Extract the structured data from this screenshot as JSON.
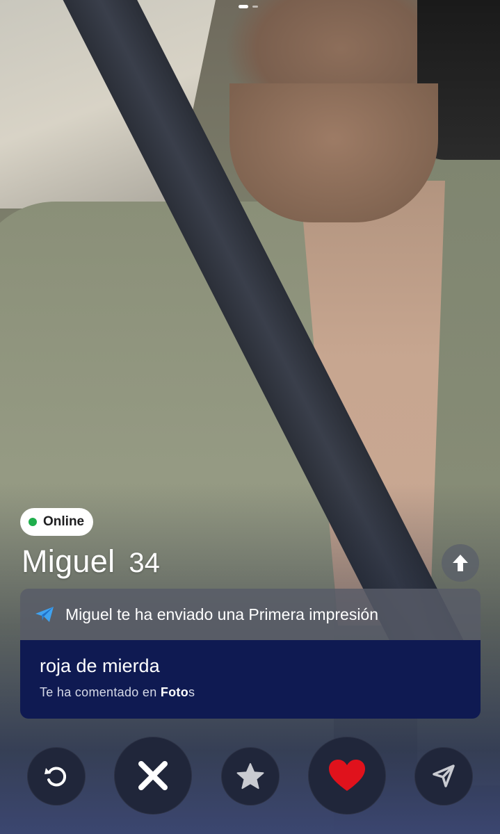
{
  "status_badge": {
    "label": "Online",
    "dot_color": "#1fae4c"
  },
  "profile": {
    "name": "Miguel",
    "age": "34"
  },
  "first_impression": {
    "title": "Miguel te ha enviado una Primera impresión",
    "icon": "paper-plane-icon",
    "comment": "roja de mierda",
    "context_prefix": "Te ha comentado en ",
    "context_bold": "Foto",
    "context_suffix": "s"
  },
  "actions": [
    {
      "name": "rewind",
      "icon": "rewind-icon"
    },
    {
      "name": "nope",
      "icon": "close-icon"
    },
    {
      "name": "super-like",
      "icon": "star-icon"
    },
    {
      "name": "like",
      "icon": "heart-icon"
    },
    {
      "name": "boost",
      "icon": "send-icon"
    }
  ],
  "colors": {
    "comment_bg": "#0f1a52",
    "like_heart": "#e0121c",
    "action_bg": "#20263a"
  }
}
